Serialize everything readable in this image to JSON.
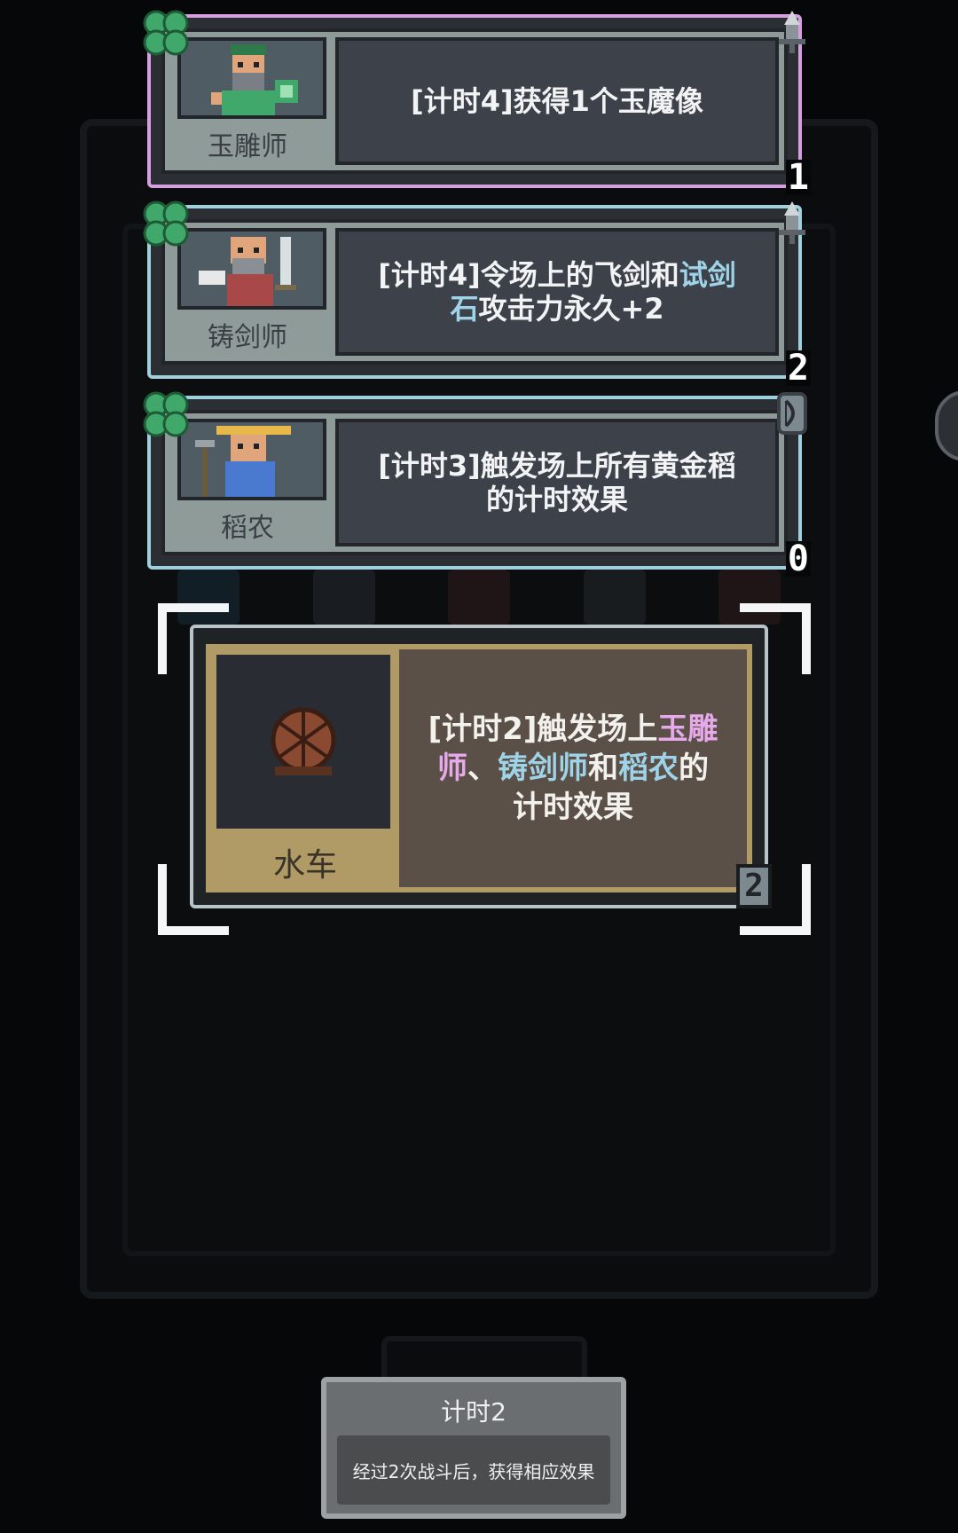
{
  "heroes": [
    {
      "name": "玉雕师",
      "desc": [
        "[计时4]获得1个玉魔像"
      ],
      "counter": "1",
      "border_color": "#d69fe0",
      "corner_icon": "sword-icon"
    },
    {
      "name": "铸剑师",
      "desc_parts": [
        "[计时4]令场上的飞剑和",
        "试剑",
        "石",
        "攻击力永久+2"
      ],
      "counter": "2",
      "border_color": "#9fd0de",
      "corner_icon": "sword-icon"
    },
    {
      "name": "稻农",
      "desc": [
        "[计时3]触发场上所有黄金稻",
        "的计时效果"
      ],
      "counter": "0",
      "border_color": "#9fd0de",
      "corner_icon": "bow-icon"
    }
  ],
  "selected_item": {
    "name": "水车",
    "desc_parts": [
      "[计时2]触发场上",
      "玉雕",
      "师",
      "、",
      "铸剑师",
      "和",
      "稻农",
      "的",
      "计时效果"
    ],
    "counter": "2",
    "icon": "waterwheel-icon"
  },
  "tooltip": {
    "title": "计时2",
    "body": "经过2次战斗后，获得相应效果"
  },
  "colors": {
    "pink_highlight": "#e6a9ea",
    "blue_highlight": "#9fd3e8",
    "clover": "#3fa86a"
  }
}
